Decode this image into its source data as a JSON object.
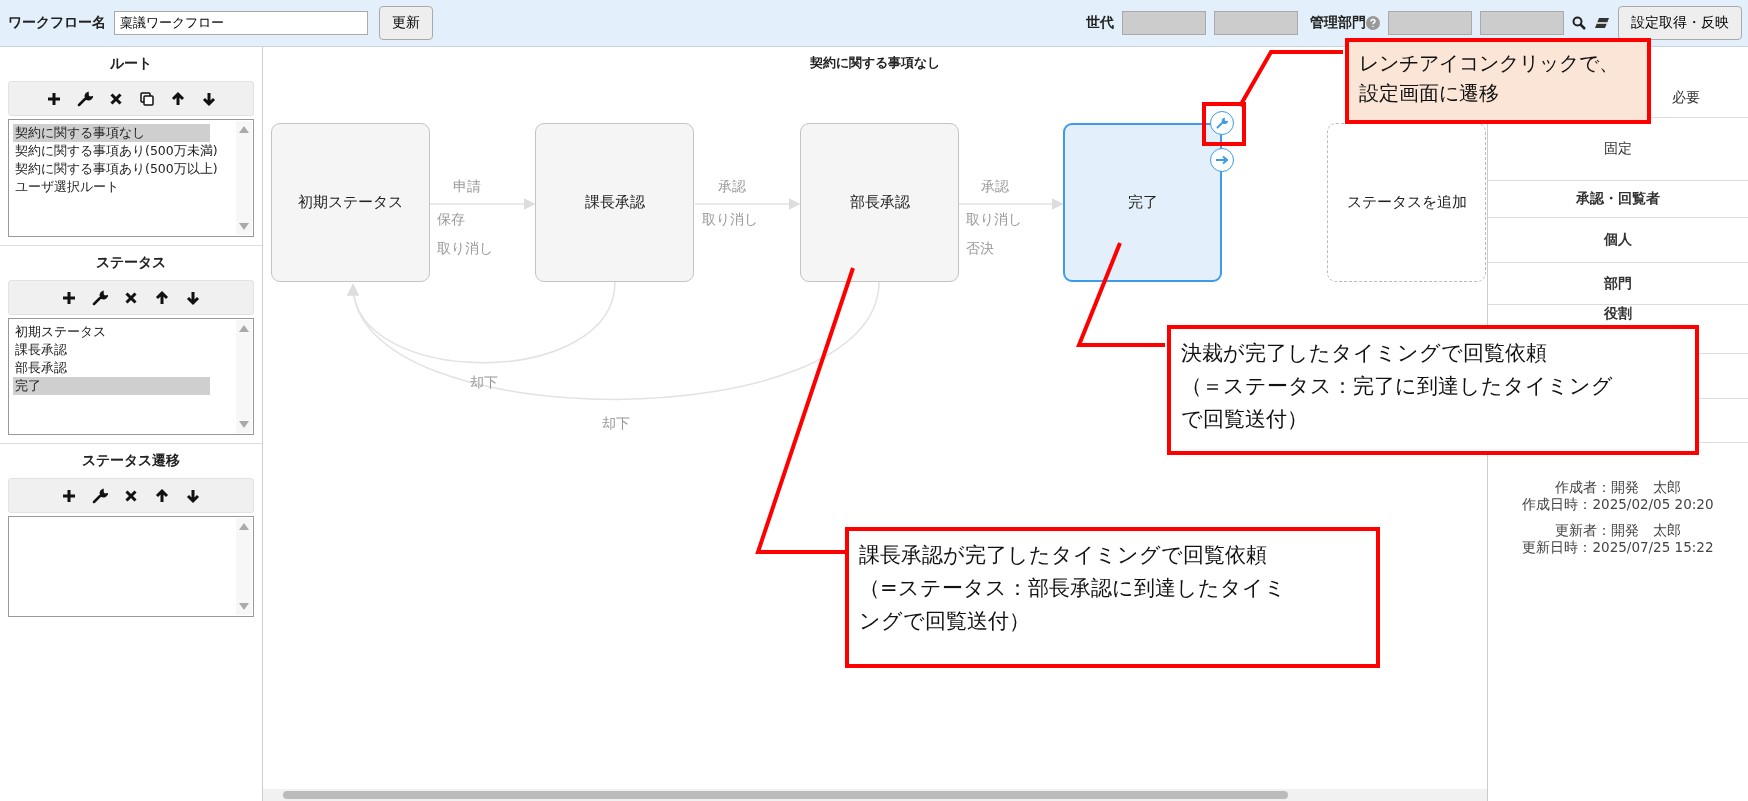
{
  "header": {
    "name_label": "ワークフロー名",
    "name_value": "稟議ワークフロー",
    "update_button": "更新",
    "generation_label": "世代",
    "department_label": "管理部門",
    "apply_button": "設定取得・反映"
  },
  "route_panel": {
    "title": "ルート",
    "items": [
      {
        "label": "契約に関する事項なし",
        "selected": true
      },
      {
        "label": "契約に関する事項あり(500万未満)",
        "selected": false
      },
      {
        "label": "契約に関する事項あり(500万以上)",
        "selected": false
      },
      {
        "label": "ユーザ選択ルート",
        "selected": false
      }
    ]
  },
  "status_panel": {
    "title": "ステータス",
    "items": [
      {
        "label": "初期ステータス",
        "selected": false
      },
      {
        "label": "課長承認",
        "selected": false
      },
      {
        "label": "部長承認",
        "selected": false
      },
      {
        "label": "完了",
        "selected": true
      }
    ]
  },
  "transition_panel": {
    "title": "ステータス遷移"
  },
  "canvas": {
    "title": "契約に関する事項なし",
    "nodes": [
      {
        "label": "初期ステータス",
        "kind": "status",
        "selected": false
      },
      {
        "label": "課長承認",
        "kind": "status",
        "selected": false
      },
      {
        "label": "部長承認",
        "kind": "status",
        "selected": false
      },
      {
        "label": "完了",
        "kind": "status",
        "selected": true
      },
      {
        "label": "ステータスを追加",
        "kind": "add",
        "selected": false
      }
    ],
    "edges": [
      {
        "labels": [
          "申請",
          "保存",
          "取り消し"
        ]
      },
      {
        "labels": [
          "承認",
          "取り消し"
        ]
      },
      {
        "labels": [
          "承認",
          "取り消し",
          "否決"
        ]
      }
    ],
    "returns": [
      {
        "label": "却下"
      },
      {
        "label": "却下"
      }
    ]
  },
  "detail_panel": {
    "rows": [
      {
        "text": "必要",
        "kind": "value"
      },
      {
        "text": "固定",
        "kind": "value"
      },
      {
        "text": "承認・回覧者",
        "kind": "heading"
      },
      {
        "text": "個人",
        "kind": "heading"
      },
      {
        "text": "部門",
        "kind": "heading"
      },
      {
        "text": "役割",
        "kind": "heading"
      },
      {
        "kind": "empty"
      },
      {
        "kind": "empty"
      }
    ],
    "meta": [
      "作成者：開発　太郎",
      "作成日時：2025/02/05 20:20",
      "更新者：開発　太郎",
      "更新日時：2025/07/25 15:22"
    ]
  },
  "callouts": [
    {
      "lines": [
        "レンチアイコンクリックで、",
        "設定画面に遷移"
      ],
      "kind": "filled"
    },
    {
      "lines": [
        "決裁が完了したタイミングで回覧依頼",
        "（＝ステータス：完了に到達したタイミング",
        "で回覧送付）"
      ],
      "kind": "outline"
    },
    {
      "lines": [
        "課長承認が完了したタイミングで回覧依頼",
        "（=ステータス：部長承認に到達したタイミ",
        "ングで回覧送付）"
      ],
      "kind": "outline"
    }
  ]
}
